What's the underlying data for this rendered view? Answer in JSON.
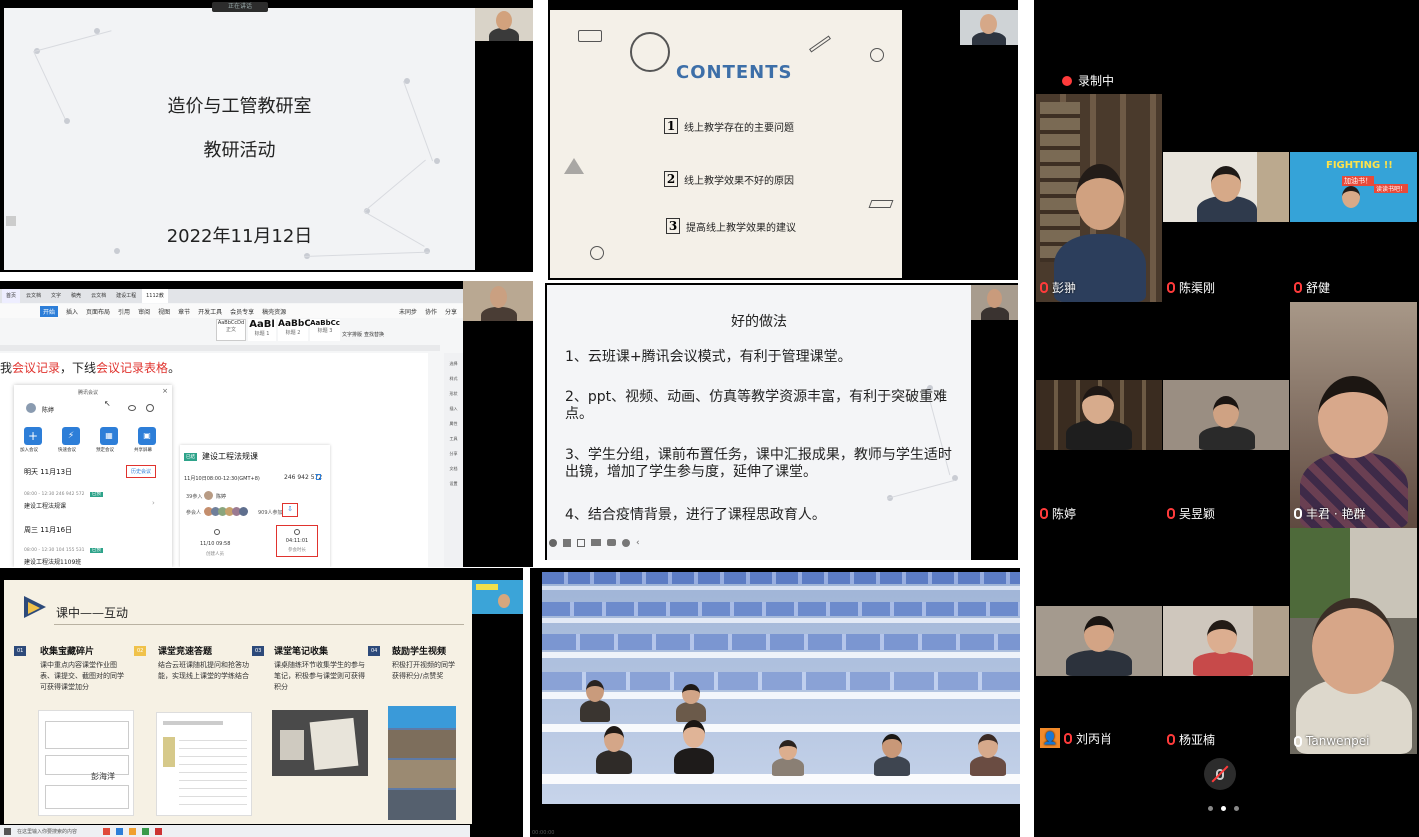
{
  "slide1": {
    "title": "造价与工管教研室",
    "subtitle": "教研活动",
    "date": "2022年11月12日",
    "top_label": "正在讲话"
  },
  "slide2": {
    "heading": "CONTENTS",
    "items": [
      {
        "num": "1",
        "text": "线上教学存在的主要问题"
      },
      {
        "num": "2",
        "text": "线上教学效果不好的原因"
      },
      {
        "num": "3",
        "text": "提高线上教学效果的建议"
      }
    ]
  },
  "doc": {
    "tabs": [
      "首页",
      "云文档",
      "文字",
      "稿壳",
      "云文档",
      "建设工程",
      "1112教"
    ],
    "ribbon": [
      "开始",
      "插入",
      "页面布局",
      "引用",
      "审阅",
      "视图",
      "章节",
      "开发工具",
      "会员专享",
      "稿壳资源"
    ],
    "styles": [
      "AaBbCcDd",
      "AaBl",
      "AaBbC",
      "AaBbCc"
    ],
    "style_labels": [
      "正文",
      "标题 1",
      "标题 2",
      "标题 3"
    ],
    "ribbon_right": [
      "文字排版",
      "查找替换"
    ],
    "top_right": [
      "未同步",
      "协作",
      "分享"
    ],
    "body_prefix": "我",
    "body_red1": "会议记录",
    "body_mid": "，下线",
    "body_red2": "会议记录表格",
    "body_end": "。",
    "meeting_app": {
      "title": "腾讯会议",
      "user": "陈婷",
      "buttons": [
        "加入会议",
        "快速会议",
        "预定会议",
        "共享屏幕"
      ],
      "day1": "明天  11月13日",
      "history": "历史会议",
      "m1_time": "08:00 - 12:30  246 942 572",
      "m1_badge": "已预",
      "m1_name": "建设工程法规课",
      "day2": "周三  11月16日",
      "m2_time": "08:00 - 12:30  104 155 531",
      "m2_badge": "已预",
      "m2_name": "建设工程法规1109班"
    },
    "meeting_card": {
      "badge": "已结",
      "title": "建设工程法规课",
      "time": "11月10日08:00-12:30(GMT+8)",
      "id": "246 942 572",
      "count": "39参入",
      "host": "陈婷",
      "participants_label": "参会人",
      "participants_count": "909人参加",
      "left_time": "11/10 09:58",
      "left_label": "创建人员",
      "right_time": "04:11:01",
      "right_label": "参会时长"
    },
    "side_tools": [
      "选择",
      "样式",
      "形状",
      "插入",
      "属性",
      "工具",
      "分享",
      "文档",
      "设置"
    ]
  },
  "slide4": {
    "title": "好的做法",
    "points": [
      "1、云班课+腾讯会议模式，有利于管理课堂。",
      "2、ppt、视频、动画、仿真等教学资源丰富，有利于突破重难点。",
      "3、学生分组，课前布置任务，课中汇报成果，教师与学生适时出镜，增加了学生参与度，延伸了课堂。",
      "4、结合疫情背景，进行了课程思政育人。"
    ]
  },
  "slide5": {
    "title": "课中——互动",
    "cards": [
      {
        "num": "01",
        "title": "收集宝藏碎片",
        "text": "课中重点内容课堂作业图表、课提交、截图对的同学可获得课堂加分"
      },
      {
        "num": "02",
        "title": "课堂竞速答题",
        "text": "结合云班课随机提问和抢答功能，实现线上课堂的学练结合"
      },
      {
        "num": "03",
        "title": "课堂笔记收集",
        "text": "课桌随练环节收集学生的参与笔记，积极参与课堂则可获得积分"
      },
      {
        "num": "04",
        "title": "鼓励学生视频",
        "text": "积极打开视频的同学获得积分/点赞奖"
      }
    ],
    "caption": "彭海洋",
    "taskbar_text": "在这里输入你要搜索的内容"
  },
  "classroom": {
    "caption": "00:00:00"
  },
  "gallery": {
    "recording": "录制中",
    "tiles": [
      {
        "name": "彭翀",
        "mic": "red"
      },
      {
        "name": "陈渠刚",
        "mic": "red"
      },
      {
        "name": "舒健",
        "mic": "red"
      },
      {
        "name": "陈婷",
        "mic": "red"
      },
      {
        "name": "吴昱颖",
        "mic": "red"
      },
      {
        "name": "丰君 · 艳群",
        "mic": "white"
      },
      {
        "name": "刘丙肖",
        "mic": "red"
      },
      {
        "name": "杨亚楠",
        "mic": "red"
      },
      {
        "name": "Tanwenpei",
        "mic": "white"
      }
    ],
    "banner_text": "FIGHTING !!",
    "banner_sub": "加油书！",
    "banner_small": "读读书吧！"
  },
  "colors": {
    "accent_red": "#e0332e",
    "teal": "#2ea38a",
    "blue": "#2d7ed8",
    "navy": "#2d4a7a"
  }
}
